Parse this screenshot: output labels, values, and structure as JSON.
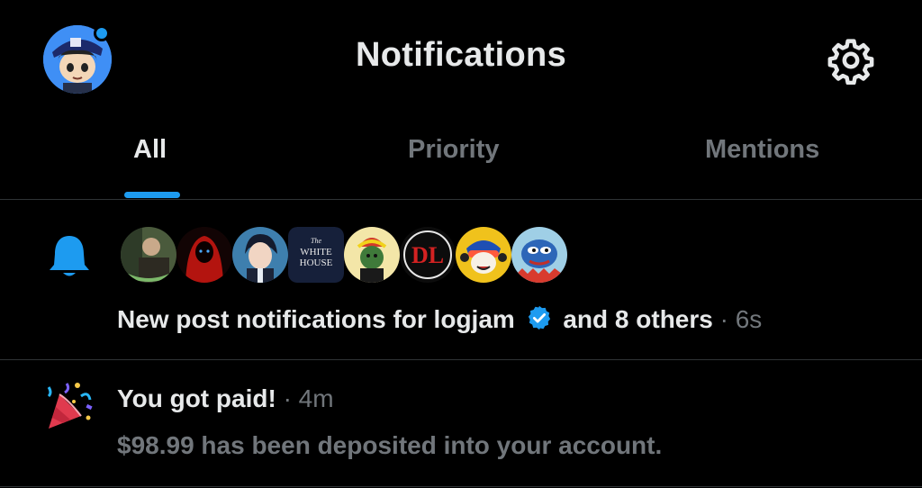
{
  "header": {
    "title": "Notifications",
    "profile_avatar_icon": "user-avatar",
    "settings_icon": "gear-icon"
  },
  "tabs": [
    {
      "label": "All",
      "active": true
    },
    {
      "label": "Priority",
      "active": false
    },
    {
      "label": "Mentions",
      "active": false
    }
  ],
  "notifications": [
    {
      "icon": "bell-icon",
      "avatars": [
        "avatar-1",
        "avatar-2",
        "avatar-3",
        "avatar-white-house",
        "avatar-5",
        "avatar-dl",
        "avatar-7",
        "avatar-pepe"
      ],
      "white_house_text_1": "The",
      "white_house_text_2": "WHITE",
      "white_house_text_3": "HOUSE",
      "dl_text": "DL",
      "text_prefix": "New post notifications for logjam",
      "text_suffix": "and 8 others",
      "separator": "·",
      "time": "6s"
    },
    {
      "icon": "party-popper-icon",
      "title": "You got paid!",
      "separator": "·",
      "time": "4m",
      "body": "$98.99 has been deposited into your account."
    }
  ],
  "colors": {
    "background": "#000000",
    "accent": "#1d9bf0",
    "text": "#e7e9ea",
    "muted": "#71767b",
    "divider": "#2f3336"
  }
}
